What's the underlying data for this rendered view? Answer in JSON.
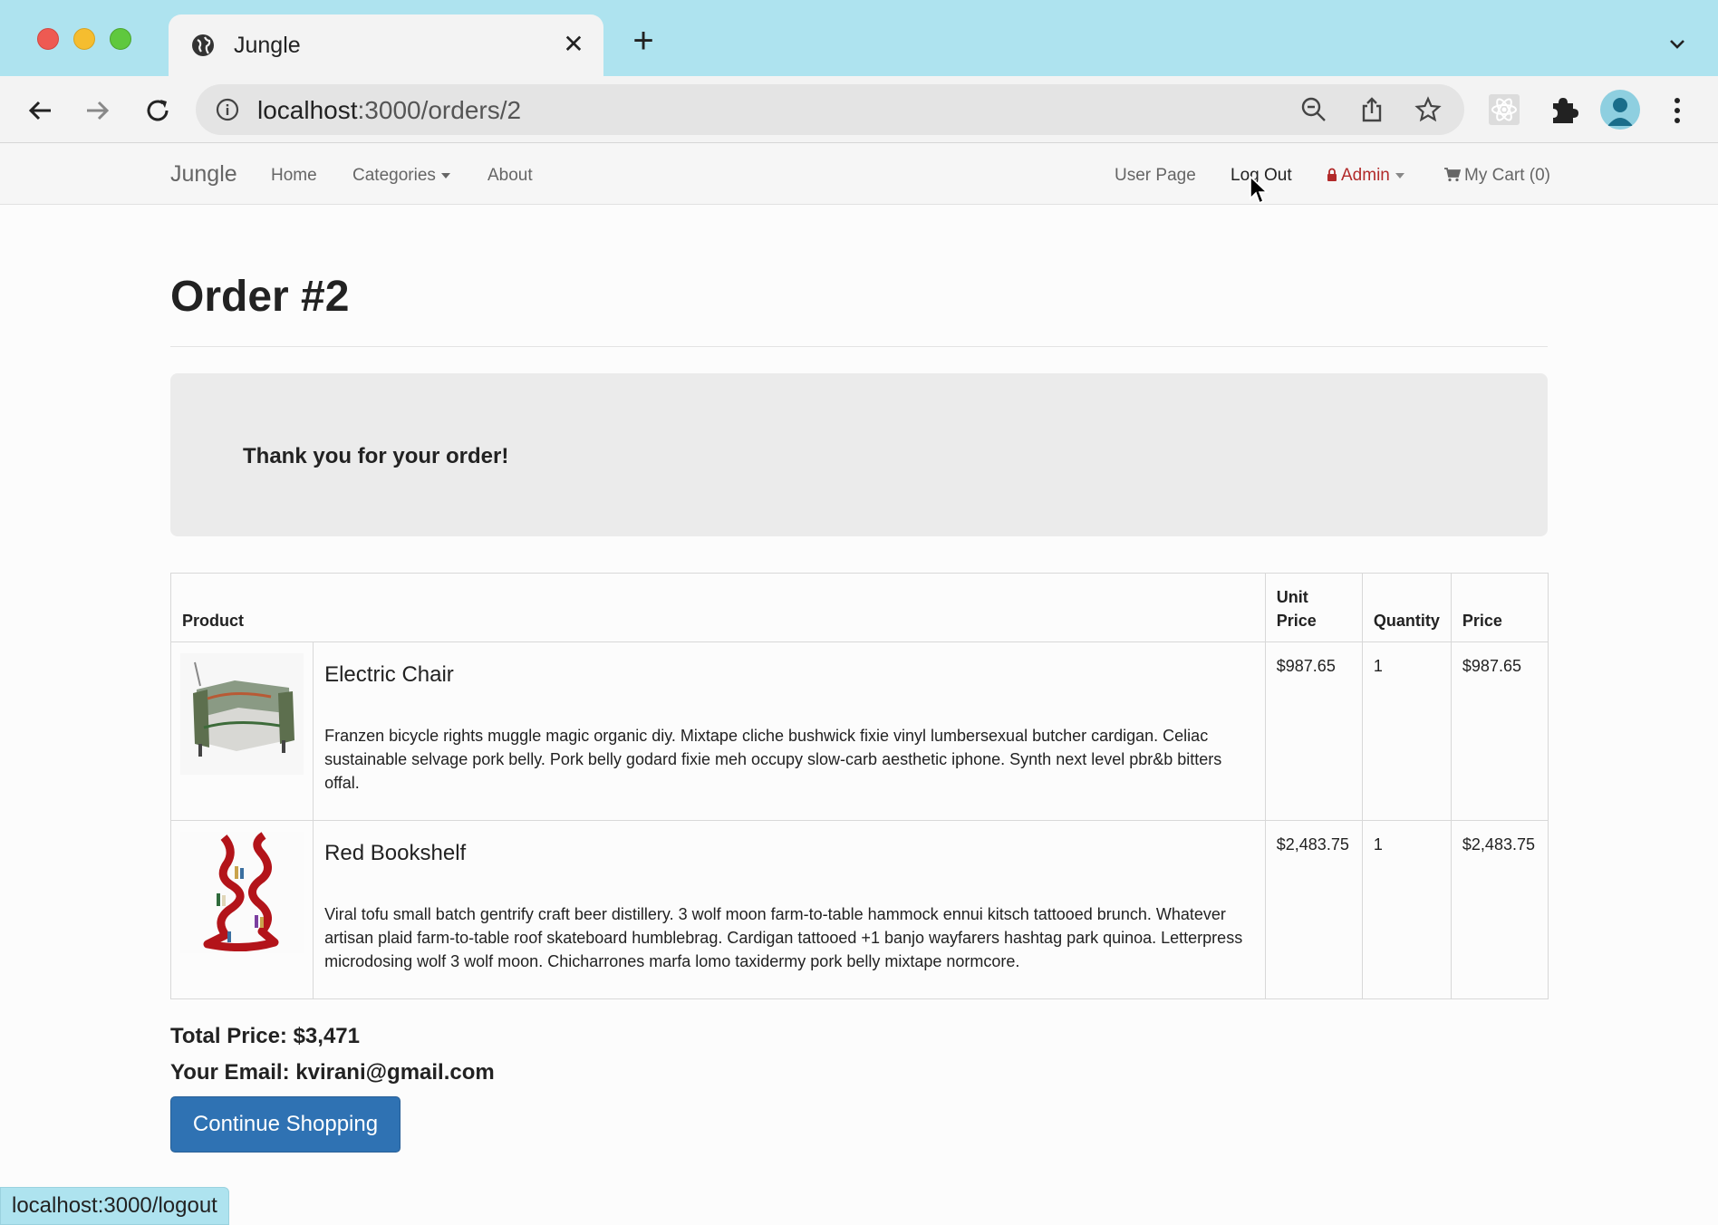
{
  "browser": {
    "tab_title": "Jungle",
    "url_host": "localhost",
    "url_path": ":3000/orders/2",
    "status_url": "localhost:3000/logout"
  },
  "nav": {
    "brand": "Jungle",
    "home": "Home",
    "categories": "Categories",
    "about": "About",
    "user_page": "User Page",
    "logout": "Log Out",
    "admin": "Admin",
    "cart": "My Cart (0)"
  },
  "page": {
    "title": "Order #2",
    "thank_you": "Thank you for your order!",
    "total": "Total Price: $3,471",
    "email": "Your Email: kvirani@gmail.com",
    "continue_label": "Continue Shopping"
  },
  "table": {
    "headers": {
      "product": "Product",
      "unit_price_1": "Unit",
      "unit_price_2": "Price",
      "quantity": "Quantity",
      "price": "Price"
    },
    "rows": [
      {
        "name": "Electric Chair",
        "description": "Franzen bicycle rights muggle magic organic diy. Mixtape cliche bushwick fixie vinyl lumbersexual butcher cardigan. Celiac sustainable selvage pork belly. Pork belly godard fixie meh occupy slow-carb aesthetic iphone. Synth next level pbr&b bitters offal.",
        "unit_price": "$987.65",
        "quantity": "1",
        "price": "$987.65"
      },
      {
        "name": "Red Bookshelf",
        "description": "Viral tofu small batch gentrify craft beer distillery. 3 wolf moon farm-to-table hammock ennui kitsch tattooed brunch. Whatever artisan plaid farm-to-table roof skateboard humblebrag. Cardigan tattooed +1 banjo wayfarers hashtag park quinoa. Letterpress microdosing wolf 3 wolf moon. Chicharrones marfa lomo taxidermy pork belly mixtape normcore.",
        "unit_price": "$2,483.75",
        "quantity": "1",
        "price": "$2,483.75"
      }
    ]
  },
  "colors": {
    "tabbar": "#aee3ef",
    "primary_button": "#2f72b3",
    "admin_link": "#b22a2a"
  }
}
